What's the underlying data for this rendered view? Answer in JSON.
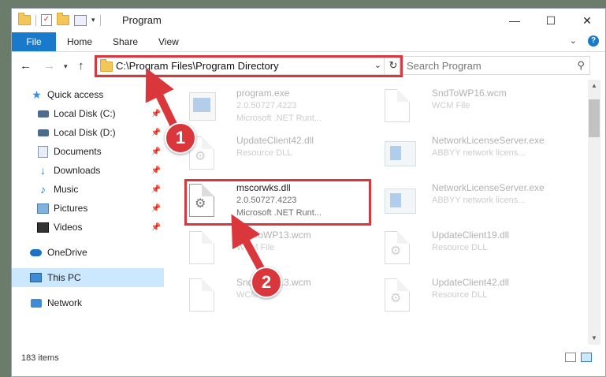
{
  "window": {
    "title": "Program"
  },
  "ribbon": {
    "file_tab": "File",
    "tabs": [
      "Home",
      "Share",
      "View"
    ]
  },
  "window_buttons": {
    "minimize": "—",
    "maximize": "☐",
    "close": "✕"
  },
  "address": {
    "path": "C:\\Program Files\\Program Directory"
  },
  "search": {
    "placeholder": "Search Program"
  },
  "sidebar": {
    "items": [
      {
        "label": "Quick access",
        "icon": "star-icon"
      },
      {
        "label": "Local Disk (C:)",
        "icon": "disk-icon",
        "pinned": true
      },
      {
        "label": "Local Disk (D:)",
        "icon": "disk-icon",
        "pinned": true
      },
      {
        "label": "Documents",
        "icon": "documents-icon",
        "pinned": true
      },
      {
        "label": "Downloads",
        "icon": "download-icon",
        "pinned": true
      },
      {
        "label": "Music",
        "icon": "music-icon",
        "pinned": true
      },
      {
        "label": "Pictures",
        "icon": "pictures-icon",
        "pinned": true
      },
      {
        "label": "Videos",
        "icon": "videos-icon",
        "pinned": true
      },
      {
        "label": "OneDrive",
        "icon": "onedrive-icon"
      },
      {
        "label": "This PC",
        "icon": "pc-icon",
        "selected": true
      },
      {
        "label": "Network",
        "icon": "network-icon"
      }
    ]
  },
  "files": {
    "left": [
      {
        "name": "program.exe",
        "line2": "2.0.50727.4223",
        "line3": "Microsoft .NET Runt...",
        "icon": "exe-icon"
      },
      {
        "name": "UpdateClient42.dll",
        "line2": "Resource DLL",
        "line3": "",
        "icon": "dll-icon"
      },
      {
        "name": "mscorwks.dll",
        "line2": "2.0.50727.4223",
        "line3": "Microsoft .NET Runt...",
        "icon": "dll-icon",
        "highlight": true
      },
      {
        "name": "SndToWP13.wcm",
        "line2": "WCM File",
        "line3": "",
        "icon": "file-icon"
      },
      {
        "name": "SndToWP13.wcm",
        "line2": "WCM File",
        "line3": "",
        "icon": "file-icon"
      }
    ],
    "right": [
      {
        "name": "SndToWP16.wcm",
        "line2": "WCM File",
        "line3": "",
        "icon": "file-icon"
      },
      {
        "name": "NetworkLicenseServer.exe",
        "line2": "ABBYY network licens...",
        "line3": "",
        "icon": "app-icon"
      },
      {
        "name": "NetworkLicenseServer.exe",
        "line2": "ABBYY network licens...",
        "line3": "",
        "icon": "app-icon"
      },
      {
        "name": "UpdateClient19.dll",
        "line2": "Resource DLL",
        "line3": "",
        "icon": "dll-icon"
      },
      {
        "name": "UpdateClient42.dll",
        "line2": "Resource DLL",
        "line3": "",
        "icon": "dll-icon"
      }
    ]
  },
  "annotations": {
    "step1": "1",
    "step2": "2",
    "color": "#d9373c"
  },
  "status": {
    "item_count": "183 items"
  }
}
